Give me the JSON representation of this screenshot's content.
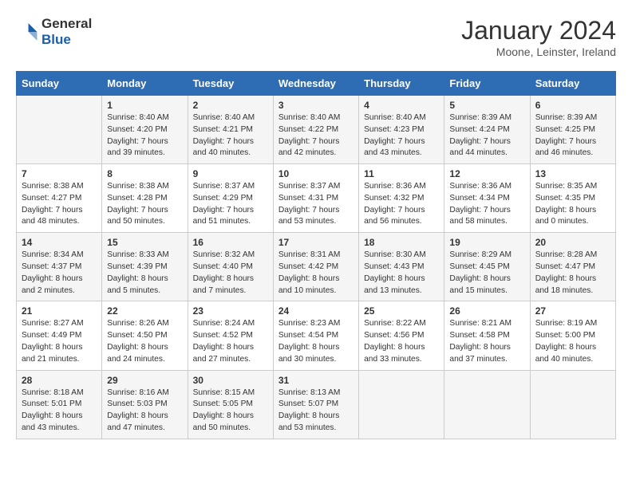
{
  "header": {
    "logo_general": "General",
    "logo_blue": "Blue",
    "title": "January 2024",
    "location": "Moone, Leinster, Ireland"
  },
  "columns": [
    "Sunday",
    "Monday",
    "Tuesday",
    "Wednesday",
    "Thursday",
    "Friday",
    "Saturday"
  ],
  "weeks": [
    [
      {
        "day": "",
        "sunrise": "",
        "sunset": "",
        "daylight": ""
      },
      {
        "day": "1",
        "sunrise": "Sunrise: 8:40 AM",
        "sunset": "Sunset: 4:20 PM",
        "daylight": "Daylight: 7 hours and 39 minutes."
      },
      {
        "day": "2",
        "sunrise": "Sunrise: 8:40 AM",
        "sunset": "Sunset: 4:21 PM",
        "daylight": "Daylight: 7 hours and 40 minutes."
      },
      {
        "day": "3",
        "sunrise": "Sunrise: 8:40 AM",
        "sunset": "Sunset: 4:22 PM",
        "daylight": "Daylight: 7 hours and 42 minutes."
      },
      {
        "day": "4",
        "sunrise": "Sunrise: 8:40 AM",
        "sunset": "Sunset: 4:23 PM",
        "daylight": "Daylight: 7 hours and 43 minutes."
      },
      {
        "day": "5",
        "sunrise": "Sunrise: 8:39 AM",
        "sunset": "Sunset: 4:24 PM",
        "daylight": "Daylight: 7 hours and 44 minutes."
      },
      {
        "day": "6",
        "sunrise": "Sunrise: 8:39 AM",
        "sunset": "Sunset: 4:25 PM",
        "daylight": "Daylight: 7 hours and 46 minutes."
      }
    ],
    [
      {
        "day": "7",
        "sunrise": "Sunrise: 8:38 AM",
        "sunset": "Sunset: 4:27 PM",
        "daylight": "Daylight: 7 hours and 48 minutes."
      },
      {
        "day": "8",
        "sunrise": "Sunrise: 8:38 AM",
        "sunset": "Sunset: 4:28 PM",
        "daylight": "Daylight: 7 hours and 50 minutes."
      },
      {
        "day": "9",
        "sunrise": "Sunrise: 8:37 AM",
        "sunset": "Sunset: 4:29 PM",
        "daylight": "Daylight: 7 hours and 51 minutes."
      },
      {
        "day": "10",
        "sunrise": "Sunrise: 8:37 AM",
        "sunset": "Sunset: 4:31 PM",
        "daylight": "Daylight: 7 hours and 53 minutes."
      },
      {
        "day": "11",
        "sunrise": "Sunrise: 8:36 AM",
        "sunset": "Sunset: 4:32 PM",
        "daylight": "Daylight: 7 hours and 56 minutes."
      },
      {
        "day": "12",
        "sunrise": "Sunrise: 8:36 AM",
        "sunset": "Sunset: 4:34 PM",
        "daylight": "Daylight: 7 hours and 58 minutes."
      },
      {
        "day": "13",
        "sunrise": "Sunrise: 8:35 AM",
        "sunset": "Sunset: 4:35 PM",
        "daylight": "Daylight: 8 hours and 0 minutes."
      }
    ],
    [
      {
        "day": "14",
        "sunrise": "Sunrise: 8:34 AM",
        "sunset": "Sunset: 4:37 PM",
        "daylight": "Daylight: 8 hours and 2 minutes."
      },
      {
        "day": "15",
        "sunrise": "Sunrise: 8:33 AM",
        "sunset": "Sunset: 4:39 PM",
        "daylight": "Daylight: 8 hours and 5 minutes."
      },
      {
        "day": "16",
        "sunrise": "Sunrise: 8:32 AM",
        "sunset": "Sunset: 4:40 PM",
        "daylight": "Daylight: 8 hours and 7 minutes."
      },
      {
        "day": "17",
        "sunrise": "Sunrise: 8:31 AM",
        "sunset": "Sunset: 4:42 PM",
        "daylight": "Daylight: 8 hours and 10 minutes."
      },
      {
        "day": "18",
        "sunrise": "Sunrise: 8:30 AM",
        "sunset": "Sunset: 4:43 PM",
        "daylight": "Daylight: 8 hours and 13 minutes."
      },
      {
        "day": "19",
        "sunrise": "Sunrise: 8:29 AM",
        "sunset": "Sunset: 4:45 PM",
        "daylight": "Daylight: 8 hours and 15 minutes."
      },
      {
        "day": "20",
        "sunrise": "Sunrise: 8:28 AM",
        "sunset": "Sunset: 4:47 PM",
        "daylight": "Daylight: 8 hours and 18 minutes."
      }
    ],
    [
      {
        "day": "21",
        "sunrise": "Sunrise: 8:27 AM",
        "sunset": "Sunset: 4:49 PM",
        "daylight": "Daylight: 8 hours and 21 minutes."
      },
      {
        "day": "22",
        "sunrise": "Sunrise: 8:26 AM",
        "sunset": "Sunset: 4:50 PM",
        "daylight": "Daylight: 8 hours and 24 minutes."
      },
      {
        "day": "23",
        "sunrise": "Sunrise: 8:24 AM",
        "sunset": "Sunset: 4:52 PM",
        "daylight": "Daylight: 8 hours and 27 minutes."
      },
      {
        "day": "24",
        "sunrise": "Sunrise: 8:23 AM",
        "sunset": "Sunset: 4:54 PM",
        "daylight": "Daylight: 8 hours and 30 minutes."
      },
      {
        "day": "25",
        "sunrise": "Sunrise: 8:22 AM",
        "sunset": "Sunset: 4:56 PM",
        "daylight": "Daylight: 8 hours and 33 minutes."
      },
      {
        "day": "26",
        "sunrise": "Sunrise: 8:21 AM",
        "sunset": "Sunset: 4:58 PM",
        "daylight": "Daylight: 8 hours and 37 minutes."
      },
      {
        "day": "27",
        "sunrise": "Sunrise: 8:19 AM",
        "sunset": "Sunset: 5:00 PM",
        "daylight": "Daylight: 8 hours and 40 minutes."
      }
    ],
    [
      {
        "day": "28",
        "sunrise": "Sunrise: 8:18 AM",
        "sunset": "Sunset: 5:01 PM",
        "daylight": "Daylight: 8 hours and 43 minutes."
      },
      {
        "day": "29",
        "sunrise": "Sunrise: 8:16 AM",
        "sunset": "Sunset: 5:03 PM",
        "daylight": "Daylight: 8 hours and 47 minutes."
      },
      {
        "day": "30",
        "sunrise": "Sunrise: 8:15 AM",
        "sunset": "Sunset: 5:05 PM",
        "daylight": "Daylight: 8 hours and 50 minutes."
      },
      {
        "day": "31",
        "sunrise": "Sunrise: 8:13 AM",
        "sunset": "Sunset: 5:07 PM",
        "daylight": "Daylight: 8 hours and 53 minutes."
      },
      {
        "day": "",
        "sunrise": "",
        "sunset": "",
        "daylight": ""
      },
      {
        "day": "",
        "sunrise": "",
        "sunset": "",
        "daylight": ""
      },
      {
        "day": "",
        "sunrise": "",
        "sunset": "",
        "daylight": ""
      }
    ]
  ]
}
